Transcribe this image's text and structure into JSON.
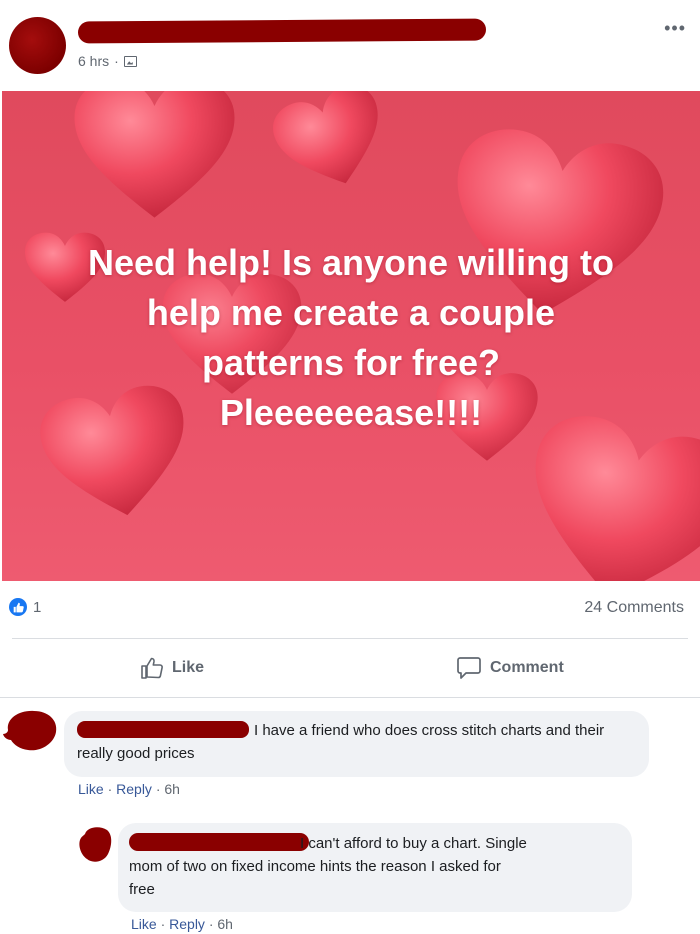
{
  "post": {
    "time": "6 hrs",
    "time_separator": "·",
    "more_icon": "more-horizontal-icon",
    "image_text_lines": [
      "Need help! Is anyone willing to",
      "help me create a couple",
      "patterns for free?",
      "Pleeeeeease!!!!"
    ],
    "image_background": "#e95066",
    "reaction_count": "1",
    "comments_count": "24 Comments"
  },
  "actions": {
    "like_label": "Like",
    "comment_label": "Comment"
  },
  "comments": [
    {
      "text_line1": "I have a friend who does cross stitch charts and their",
      "text_line2": "really good prices",
      "like": "Like",
      "reply": "Reply",
      "sep": "·",
      "time": "6h"
    },
    {
      "text_line1": "I can't afford to buy a chart. Single",
      "text_line2": "mom of two on fixed income hints the reason I asked for",
      "text_line3": "free",
      "like": "Like",
      "reply": "Reply",
      "sep": "·",
      "time": "6h"
    }
  ],
  "colors": {
    "redaction": "#8a0000",
    "link": "#385898",
    "facebook_blue": "#1877f2",
    "muted": "#606770"
  }
}
